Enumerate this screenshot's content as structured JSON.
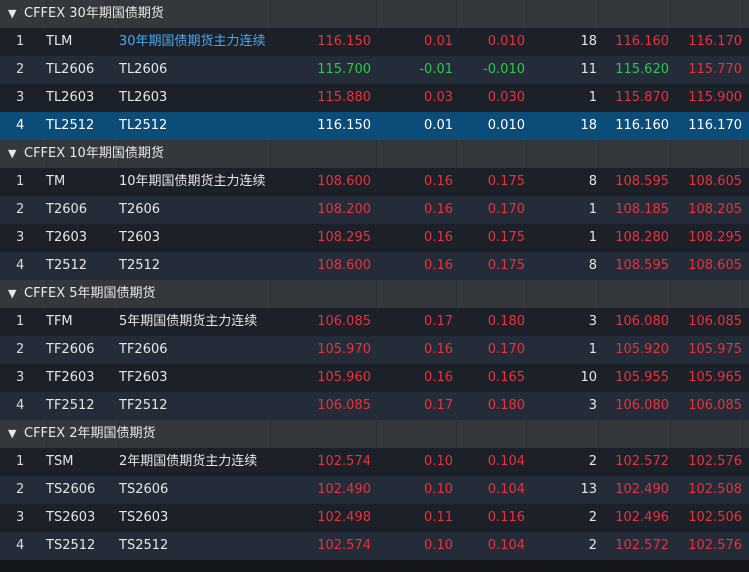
{
  "groups": [
    {
      "title": "CFFEX 30年期国债期货",
      "rows": [
        {
          "idx": "1",
          "code": "TLM",
          "name": "30年期国债期货主力连续",
          "price": "116.150",
          "chg": "0.01",
          "pct": "0.010",
          "vol": "18",
          "bid": "116.160",
          "ask": "116.170",
          "dir": "up",
          "link": true,
          "selected": false
        },
        {
          "idx": "2",
          "code": "TL2606",
          "name": "TL2606",
          "price": "115.700",
          "chg": "-0.01",
          "pct": "-0.010",
          "vol": "11",
          "bid": "115.620",
          "ask": "115.770",
          "dir": "down",
          "bidDir": "down",
          "askDir": "up",
          "link": false,
          "selected": false
        },
        {
          "idx": "3",
          "code": "TL2603",
          "name": "TL2603",
          "price": "115.880",
          "chg": "0.03",
          "pct": "0.030",
          "vol": "1",
          "bid": "115.870",
          "ask": "115.900",
          "dir": "up",
          "link": false,
          "selected": false
        },
        {
          "idx": "4",
          "code": "TL2512",
          "name": "TL2512",
          "price": "116.150",
          "chg": "0.01",
          "pct": "0.010",
          "vol": "18",
          "bid": "116.160",
          "ask": "116.170",
          "dir": "up",
          "link": false,
          "selected": true
        }
      ]
    },
    {
      "title": "CFFEX 10年期国债期货",
      "rows": [
        {
          "idx": "1",
          "code": "TM",
          "name": "10年期国债期货主力连续",
          "price": "108.600",
          "chg": "0.16",
          "pct": "0.175",
          "vol": "8",
          "bid": "108.595",
          "ask": "108.605",
          "dir": "up",
          "link": false,
          "selected": false
        },
        {
          "idx": "2",
          "code": "T2606",
          "name": "T2606",
          "price": "108.200",
          "chg": "0.16",
          "pct": "0.170",
          "vol": "1",
          "bid": "108.185",
          "ask": "108.205",
          "dir": "up",
          "link": false,
          "selected": false
        },
        {
          "idx": "3",
          "code": "T2603",
          "name": "T2603",
          "price": "108.295",
          "chg": "0.16",
          "pct": "0.175",
          "vol": "1",
          "bid": "108.280",
          "ask": "108.295",
          "dir": "up",
          "link": false,
          "selected": false
        },
        {
          "idx": "4",
          "code": "T2512",
          "name": "T2512",
          "price": "108.600",
          "chg": "0.16",
          "pct": "0.175",
          "vol": "8",
          "bid": "108.595",
          "ask": "108.605",
          "dir": "up",
          "link": false,
          "selected": false
        }
      ]
    },
    {
      "title": "CFFEX 5年期国债期货",
      "rows": [
        {
          "idx": "1",
          "code": "TFM",
          "name": "5年期国债期货主力连续",
          "price": "106.085",
          "chg": "0.17",
          "pct": "0.180",
          "vol": "3",
          "bid": "106.080",
          "ask": "106.085",
          "dir": "up",
          "link": false,
          "selected": false
        },
        {
          "idx": "2",
          "code": "TF2606",
          "name": "TF2606",
          "price": "105.970",
          "chg": "0.16",
          "pct": "0.170",
          "vol": "1",
          "bid": "105.920",
          "ask": "105.975",
          "dir": "up",
          "link": false,
          "selected": false
        },
        {
          "idx": "3",
          "code": "TF2603",
          "name": "TF2603",
          "price": "105.960",
          "chg": "0.16",
          "pct": "0.165",
          "vol": "10",
          "bid": "105.955",
          "ask": "105.965",
          "dir": "up",
          "link": false,
          "selected": false
        },
        {
          "idx": "4",
          "code": "TF2512",
          "name": "TF2512",
          "price": "106.085",
          "chg": "0.17",
          "pct": "0.180",
          "vol": "3",
          "bid": "106.080",
          "ask": "106.085",
          "dir": "up",
          "link": false,
          "selected": false
        }
      ]
    },
    {
      "title": "CFFEX 2年期国债期货",
      "rows": [
        {
          "idx": "1",
          "code": "TSM",
          "name": "2年期国债期货主力连续",
          "price": "102.574",
          "chg": "0.10",
          "pct": "0.104",
          "vol": "2",
          "bid": "102.572",
          "ask": "102.576",
          "dir": "up",
          "link": false,
          "selected": false
        },
        {
          "idx": "2",
          "code": "TS2606",
          "name": "TS2606",
          "price": "102.490",
          "chg": "0.10",
          "pct": "0.104",
          "vol": "13",
          "bid": "102.490",
          "ask": "102.508",
          "dir": "up",
          "link": false,
          "selected": false
        },
        {
          "idx": "3",
          "code": "TS2603",
          "name": "TS2603",
          "price": "102.498",
          "chg": "0.11",
          "pct": "0.116",
          "vol": "2",
          "bid": "102.496",
          "ask": "102.506",
          "dir": "up",
          "link": false,
          "selected": false
        },
        {
          "idx": "4",
          "code": "TS2512",
          "name": "TS2512",
          "price": "102.574",
          "chg": "0.10",
          "pct": "0.104",
          "vol": "2",
          "bid": "102.572",
          "ask": "102.576",
          "dir": "up",
          "link": false,
          "selected": false
        }
      ]
    }
  ],
  "icons": {
    "group_toggle": "triangle-down-icon"
  },
  "colors": {
    "up": "#e8323c",
    "down": "#2ec84a",
    "selected_row": "#0b4d78",
    "link": "#4aa8e8"
  }
}
